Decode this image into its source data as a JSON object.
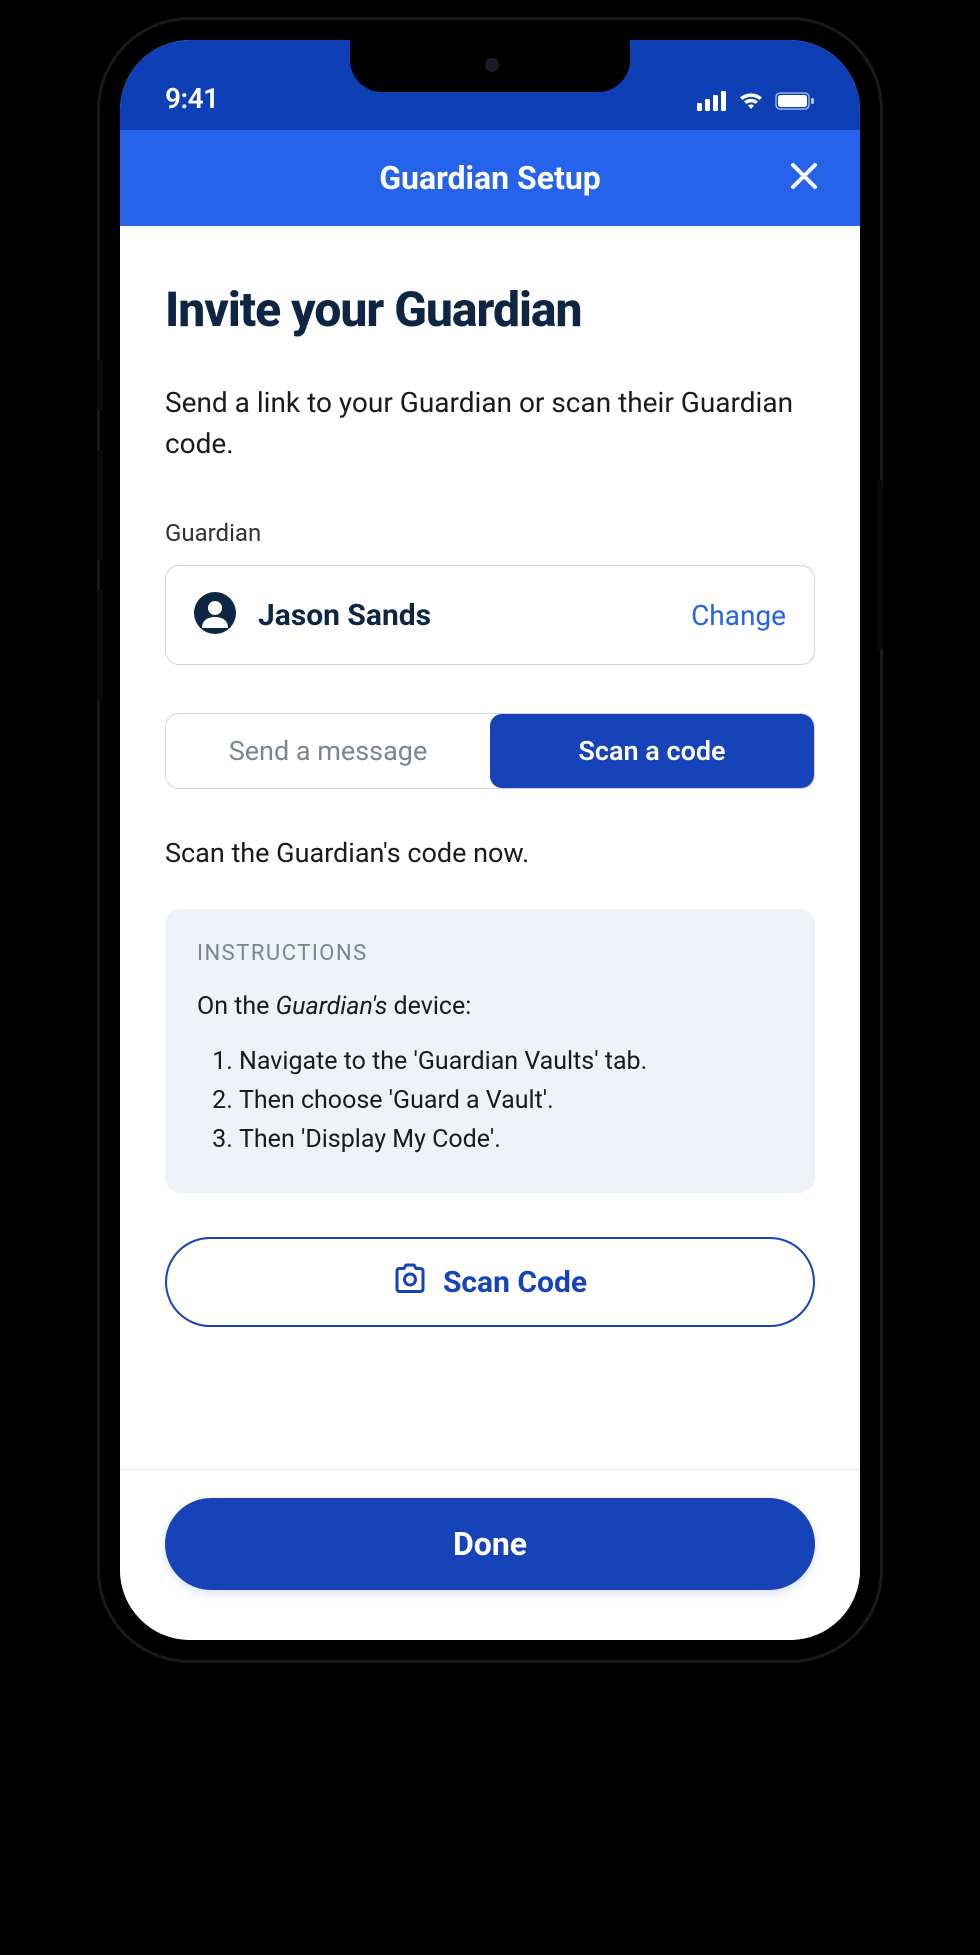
{
  "status_bar": {
    "time": "9:41"
  },
  "nav": {
    "title": "Guardian Setup"
  },
  "page": {
    "title": "Invite your Guardian",
    "subtitle": "Send a link to your Guardian or scan their Guardian code.",
    "field_label": "Guardian"
  },
  "guardian": {
    "name": "Jason Sands",
    "change_label": "Change"
  },
  "tabs": {
    "message": "Send a message",
    "scan": "Scan a code"
  },
  "instruction_lead": "Scan the Guardian's code now.",
  "instructions": {
    "title": "INSTRUCTIONS",
    "lead_pre": "On the ",
    "lead_em": "Guardian's",
    "lead_post": " device:",
    "steps": [
      "Navigate to the 'Guardian Vaults' tab.",
      "Then choose 'Guard a Vault'.",
      "Then 'Display My Code'."
    ]
  },
  "scan_button": "Scan Code",
  "done_button": "Done"
}
